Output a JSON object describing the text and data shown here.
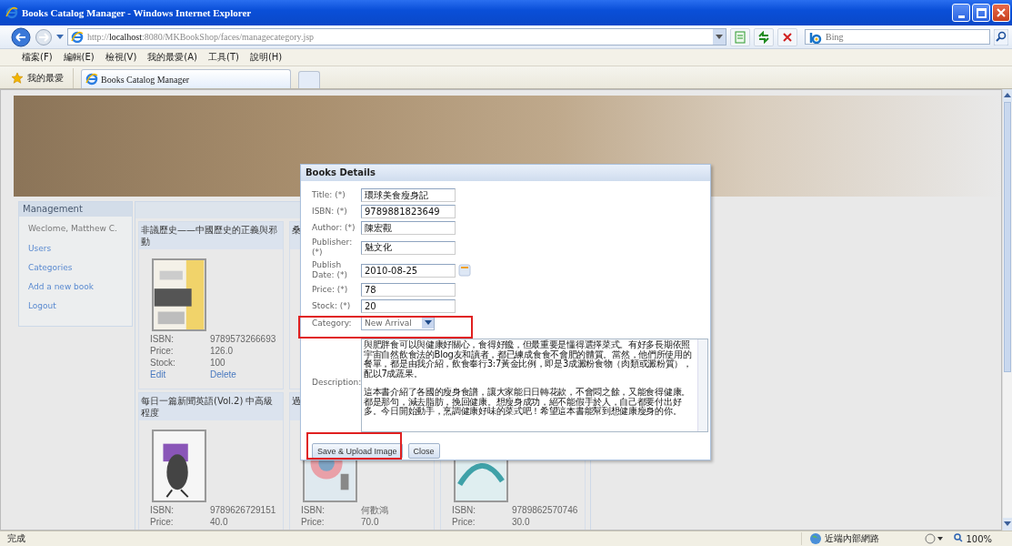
{
  "window": {
    "title": "Books Catalog Manager - Windows Internet Explorer"
  },
  "address_bar": {
    "url": "http://**localhost**:8080/MKBookShop/faces/managecategory.jsp"
  },
  "search": {
    "placeholder": "Bing"
  },
  "menu": [
    "檔案(F)",
    "編輯(E)",
    "檢視(V)",
    "我的最愛(A)",
    "工具(T)",
    "說明(H)"
  ],
  "favorites": {
    "label": "我的最愛"
  },
  "tabs": [
    {
      "label": "Books Catalog Manager",
      "selected": true
    }
  ],
  "sidebar": {
    "title": "Management",
    "welcome": "Weclome, Matthew C.",
    "links": [
      "Users",
      "Categories",
      "Add a new book",
      "Logout"
    ]
  },
  "book_rows": [
    [
      {
        "title": "非議歷史——中國歷史的正義與邪動",
        "kind": "java",
        "fields": [
          {
            "label": "ISBN:",
            "value": "9789573266693"
          },
          {
            "label": "Price:",
            "value": "126.0"
          },
          {
            "label": "Stock:",
            "value": "100"
          }
        ],
        "links": [
          "Edit",
          "Delete"
        ]
      },
      {
        "title": "桑"
      }
    ],
    [
      {
        "title": "每日一篇新聞英語(Vol.2) 中高級程度",
        "kind": "bird",
        "fields": [
          {
            "label": "ISBN:",
            "value": "9789626729151"
          },
          {
            "label": "Price:",
            "value": "40.0"
          }
        ]
      },
      {
        "title": "過",
        "kind": "circle",
        "fields": [
          {
            "label": "ISBN:",
            "value": "何歡鴻"
          },
          {
            "label": "Price:",
            "value": "70.0"
          }
        ]
      },
      {
        "kind": "java7",
        "fields": [
          {
            "label": "ISBN:",
            "value": "9789862570746"
          },
          {
            "label": "Price:",
            "value": "30.0"
          }
        ]
      }
    ]
  ],
  "dialog": {
    "title": "Books Details",
    "fields": [
      {
        "kind": "text",
        "label": "Title: (*)",
        "value": "環球美食瘦身記"
      },
      {
        "kind": "text",
        "label": "ISBN: (*)",
        "value": "9789881823649"
      },
      {
        "kind": "text",
        "label": "Author: (*)",
        "value": "陳宏觀"
      },
      {
        "kind": "text",
        "label": "Publisher: (*)",
        "value": "魅文化"
      },
      {
        "kind": "date",
        "label": "Publish Date: (*)",
        "value": "2010-08-25"
      },
      {
        "kind": "text",
        "label": "Price: (*)",
        "value": "78"
      },
      {
        "kind": "text",
        "label": "Stock: (*)",
        "value": "20"
      },
      {
        "kind": "select",
        "label": "Category:",
        "value": "New Arrival"
      },
      {
        "kind": "textarea",
        "label": "Description:",
        "paragraphs": [
          "與肥胖食可以與健康好關心，食得好饞，但最重要是懂得選擇菜式。有好多長期依照宇宙自然飲食法的Blog友和讀者，都已練成食食不會肥的體質。當然，他們所使用的餐單，都是由我介紹，飲食奉行3:7黃金比例，即是3成澱粉食物（肉類或澱粉質），配以7成蔬果。",
          "這本書介紹了各國的瘦身食譜，讓大家能日日轉花款，不會悶之餘，又能食得健康。都是那句，減去脂肪，挽回健康。想瘦身成功，絕不能假手於人，自己都要付出好多。今日開始動手，烹調健康好味的菜式吧！希望這本書能幫到想健康瘦身的你。"
        ]
      }
    ],
    "buttons": [
      "Save & Upload Image",
      "Close"
    ]
  },
  "status_bar": {
    "text": "完成",
    "zone": "近端內部網路",
    "zoom": "100%"
  }
}
